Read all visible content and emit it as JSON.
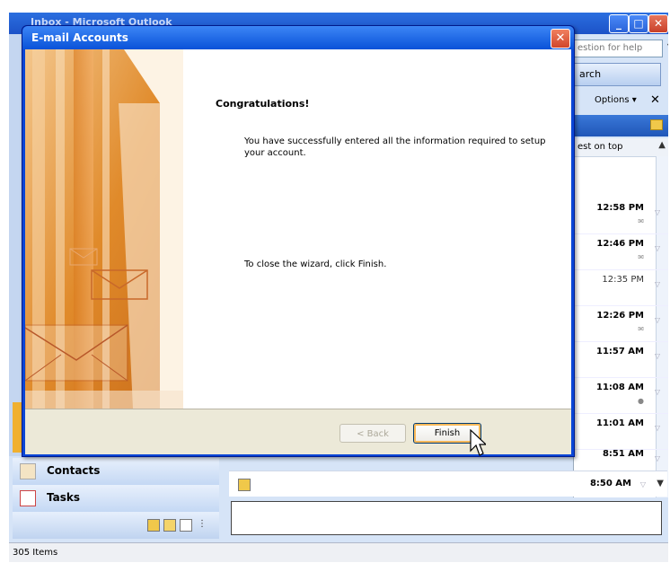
{
  "outlook": {
    "title": "Inbox - Microsoft Outlook",
    "help_placeholder": "estion for help",
    "search_label": "arch",
    "options_label": "Options ▾",
    "sort_label": "est on top",
    "messages": [
      {
        "time": "12:58 PM",
        "bold": true
      },
      {
        "time": "12:46 PM",
        "bold": true
      },
      {
        "time": "12:35 PM",
        "bold": false
      },
      {
        "time": "12:26 PM",
        "bold": true
      },
      {
        "time": "11:57 AM",
        "bold": true
      },
      {
        "time": "11:08 AM",
        "bold": true
      },
      {
        "time": "11:01 AM",
        "bold": true
      },
      {
        "time": "8:51 AM",
        "bold": true
      },
      {
        "time": "8:50 AM",
        "bold": true
      }
    ],
    "nav": {
      "contacts": "Contacts",
      "tasks": "Tasks"
    },
    "status": "305 Items"
  },
  "dialog": {
    "title": "E-mail Accounts",
    "close_glyph": "✕",
    "heading": "Congratulations!",
    "success_message": "You have successfully entered all the information required to setup your account.",
    "close_message": "To close the wizard, click Finish.",
    "back_label": "< Back",
    "finish_label": "Finish"
  },
  "colors": {
    "titlebar_blue": "#0a52d8",
    "art_orange": "#e08a2a",
    "finish_focus": "#f8b858"
  }
}
